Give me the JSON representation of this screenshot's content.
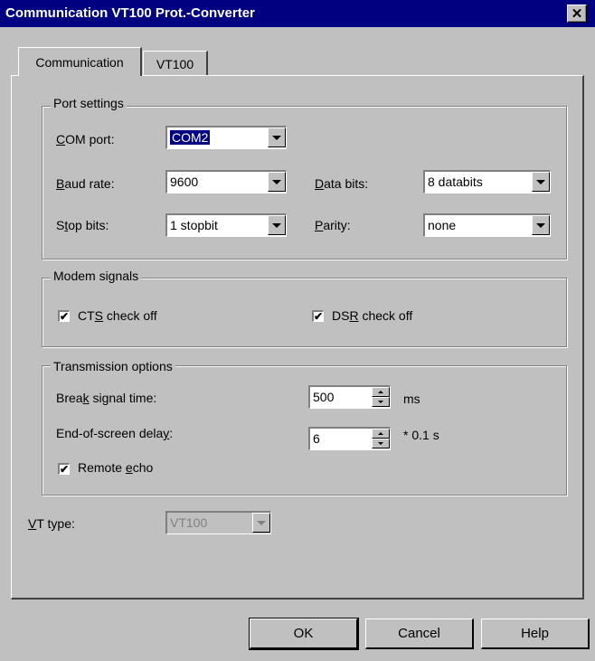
{
  "window": {
    "title": "Communication VT100 Prot.-Converter",
    "close_glyph": "✕"
  },
  "tabs": [
    {
      "label": "Communication",
      "active": true
    },
    {
      "label": "VT100",
      "active": false
    }
  ],
  "port_settings": {
    "group_label": "Port settings",
    "com_port": {
      "label_mn": "C",
      "label_rest": "OM port:",
      "value": "COM2"
    },
    "baud_rate": {
      "label_mn": "B",
      "label_rest": "aud rate:",
      "value": "9600"
    },
    "data_bits": {
      "label_mn": "D",
      "label_rest": "ata bits:",
      "value": "8 databits"
    },
    "stop_bits": {
      "label_pre": "S",
      "label_mn": "t",
      "label_rest": "op bits:",
      "value": "1 stopbit"
    },
    "parity": {
      "label_mn": "P",
      "label_rest": "arity:",
      "value": "none"
    }
  },
  "modem_signals": {
    "group_label": "Modem signals",
    "cts": {
      "label_pre": "CT",
      "label_mn": "S",
      "label_rest": " check off",
      "checked": true
    },
    "dsr": {
      "label_pre": "DS",
      "label_mn": "R",
      "label_rest": " check off",
      "checked": true
    }
  },
  "transmission": {
    "group_label": "Transmission options",
    "break_time": {
      "label_pre": "Brea",
      "label_mn": "k",
      "label_rest": " signal time:",
      "value": "500",
      "unit": "ms"
    },
    "eos_delay": {
      "label_pre": "End-of-screen dela",
      "label_mn": "y",
      "label_rest": ":",
      "value": "6",
      "unit": "* 0.1 s"
    },
    "remote_echo": {
      "label_pre": "Remote ",
      "label_mn": "e",
      "label_rest": "cho",
      "checked": true
    }
  },
  "vt_type": {
    "label_mn": "V",
    "label_rest": "T type:",
    "value": "VT100",
    "disabled": true
  },
  "buttons": {
    "ok": "OK",
    "cancel": "Cancel",
    "help": "Help"
  },
  "check_glyph": "✔"
}
